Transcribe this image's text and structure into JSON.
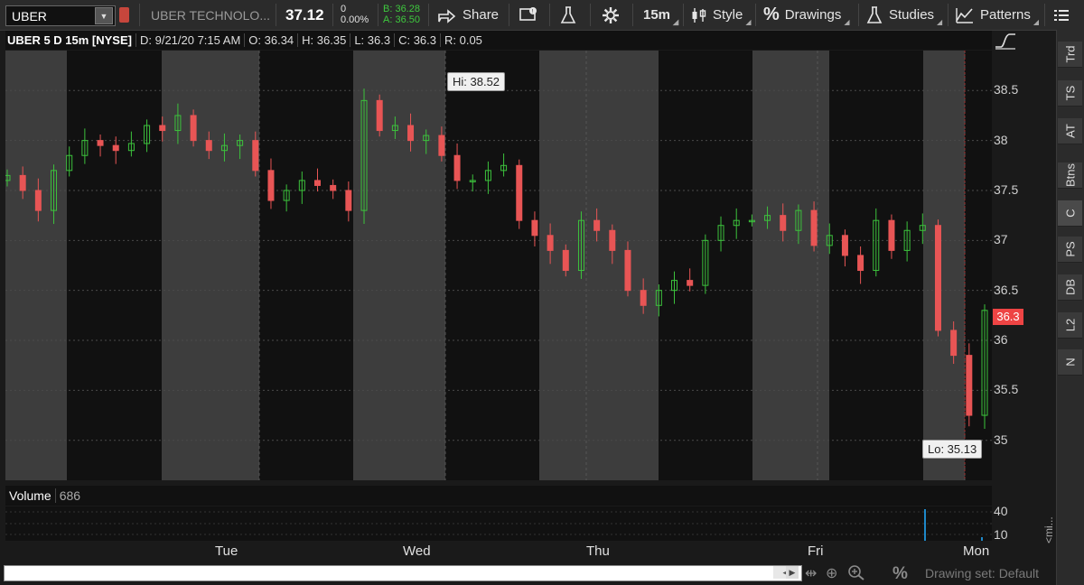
{
  "toolbar": {
    "symbol": "UBER",
    "company": "UBER TECHNOLO...",
    "last_price": "37.12",
    "change": "0",
    "change_pct": "0.00%",
    "bid": "B: 36.28",
    "ask": "A: 36.50",
    "share_label": "Share",
    "timeframe_label": "15m",
    "style_label": "Style",
    "drawings_label": "Drawings",
    "studies_label": "Studies",
    "patterns_label": "Patterns"
  },
  "chart_header": {
    "symbol_desc": "UBER 5 D 15m [NYSE]",
    "date": "D: 9/21/20 7:15 AM",
    "open": "O: 36.34",
    "high": "H: 36.35",
    "low": "L: 36.3",
    "close": "C: 36.3",
    "range": "R: 0.05"
  },
  "chart_data": {
    "type": "candlestick",
    "title": "UBER 5 D 15m [NYSE]",
    "xlabel": "",
    "ylabel": "",
    "ylim": [
      34.6,
      38.9
    ],
    "yticks": [
      "38.5",
      "38",
      "37.5",
      "37",
      "36.5",
      "36",
      "35.5",
      "35"
    ],
    "x_labels": [
      "Tue",
      "Wed",
      "Thu",
      "Fri",
      "Mon"
    ],
    "high_callout": "Hi: 38.52",
    "low_callout": "Lo: 35.13",
    "last_price_tag": "36.3",
    "approx_close_series": [
      37.65,
      37.5,
      37.3,
      37.7,
      37.85,
      38.0,
      37.95,
      37.9,
      37.97,
      38.15,
      38.1,
      38.25,
      38.0,
      37.9,
      37.95,
      38.0,
      37.7,
      37.4,
      37.5,
      37.6,
      37.55,
      37.5,
      37.3,
      38.4,
      38.1,
      38.15,
      38.0,
      38.05,
      37.85,
      37.6,
      37.6,
      37.7,
      37.75,
      37.2,
      37.05,
      36.9,
      36.7,
      37.2,
      37.1,
      36.9,
      36.5,
      36.35,
      36.5,
      36.6,
      36.55,
      37.0,
      37.15,
      37.2,
      37.2,
      37.25,
      37.1,
      37.3,
      36.95,
      37.05,
      36.85,
      36.7,
      37.2,
      36.9,
      37.1,
      37.15,
      36.1,
      35.85,
      35.25,
      36.3
    ]
  },
  "volume": {
    "label": "Volume",
    "value": "686",
    "yticks": [
      "40",
      "10"
    ]
  },
  "right_tabs": [
    "Trd",
    "TS",
    "AT",
    "Btns",
    "C",
    "PS",
    "DB",
    "L2",
    "N"
  ],
  "bottom": {
    "drawing_set": "Drawing set: Default",
    "collapse_label": "<mi..."
  }
}
